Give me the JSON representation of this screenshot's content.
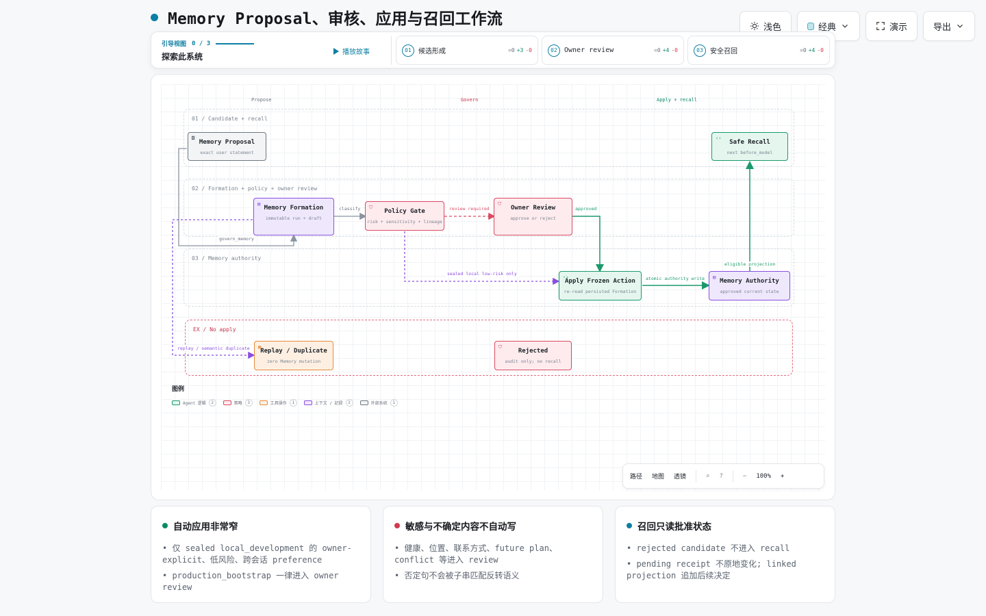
{
  "title": "Memory Proposal、审核、应用与召回工作流",
  "toolbar": {
    "theme": "浅色",
    "style": "经典",
    "present": "演示",
    "export": "导出"
  },
  "guide": {
    "label": "引导视图",
    "progress": "0 / 3",
    "subtitle": "探索此系统",
    "play": "播放故事",
    "steps": [
      {
        "num": "01",
        "label": "候选形成",
        "eq": "=0",
        "plus": "+3",
        "minus": "-0"
      },
      {
        "num": "02",
        "label": "Owner review",
        "eq": "=0",
        "plus": "+4",
        "minus": "-0"
      },
      {
        "num": "03",
        "label": "安全召回",
        "eq": "=0",
        "plus": "+4",
        "minus": "-0"
      }
    ]
  },
  "columns": {
    "propose": "Propose",
    "govern": "Govern",
    "apply": "Apply + recall"
  },
  "lanes": {
    "l1": "01 / Candidate + recall",
    "l2": "02 / Formation + policy + owner review",
    "l3": "03 / Memory authority",
    "ex": "EX / No apply"
  },
  "nodes": {
    "proposal": {
      "title": "Memory Proposal",
      "sub": "exact user statement"
    },
    "recall": {
      "title": "Safe Recall",
      "sub": "next before_model"
    },
    "formation": {
      "title": "Memory Formation",
      "sub": "immutable run + draft"
    },
    "policy": {
      "title": "Policy Gate",
      "sub": "risk + sensitivity + lineage"
    },
    "owner": {
      "title": "Owner Review",
      "sub": "approve or reject"
    },
    "apply": {
      "title": "Apply Frozen Action",
      "sub": "re-read persisted Formation"
    },
    "authority": {
      "title": "Memory Authority",
      "sub": "approved current state"
    },
    "replay": {
      "title": "Replay / Duplicate",
      "sub": "zero Memory mutation"
    },
    "rejected": {
      "title": "Rejected",
      "sub": "audit only; no recall"
    }
  },
  "edges": {
    "classify": "classify",
    "review_required": "review required",
    "approved": "approved",
    "govern_memory": "govern_memory",
    "sealed": "sealed local low-risk only",
    "atomic": "atomic authority write",
    "eligible": "eligible projection",
    "replay": "replay / semantic duplicate"
  },
  "legend": {
    "title": "图例",
    "items": [
      {
        "label": "Agent 逻辑",
        "count": "2",
        "color": "#1a9a6c",
        "fill": "#e4f6ee"
      },
      {
        "label": "策略",
        "count": "3",
        "color": "#d94a62",
        "fill": "#fdebee"
      },
      {
        "label": "工具操作",
        "count": "1",
        "color": "#e58a3a",
        "fill": "#fdf0e3"
      },
      {
        "label": "上下文 / 記録",
        "count": "2",
        "color": "#8a4fe0",
        "fill": "#efe8fd"
      },
      {
        "label": "外部系统",
        "count": "1",
        "color": "#6f7782",
        "fill": "#f2f4f6"
      }
    ]
  },
  "zoombar": {
    "path": "路径",
    "map": "地图",
    "perspective": "透镜",
    "zoom": "100%"
  },
  "cards": [
    {
      "title": "自动应用非常窄",
      "color": "#0a8a66",
      "items": [
        "• 仅 sealed local_development 的 owner-explicit、低风险、跨会话 preference",
        "• production_bootstrap 一律进入 owner review"
      ]
    },
    {
      "title": "敏感与不确定内容不自动写",
      "color": "#d13a4e",
      "items": [
        "• 健康、位置、联系方式、future plan、conflict 等进入 review",
        "• 否定句不会被子串匹配反转语义"
      ]
    },
    {
      "title": "召回只读批准状态",
      "color": "#0e7fa3",
      "items": [
        "• rejected candidate 不进入 recall",
        "• pending receipt 不原地变化; linked projection 追加后续决定"
      ]
    }
  ]
}
